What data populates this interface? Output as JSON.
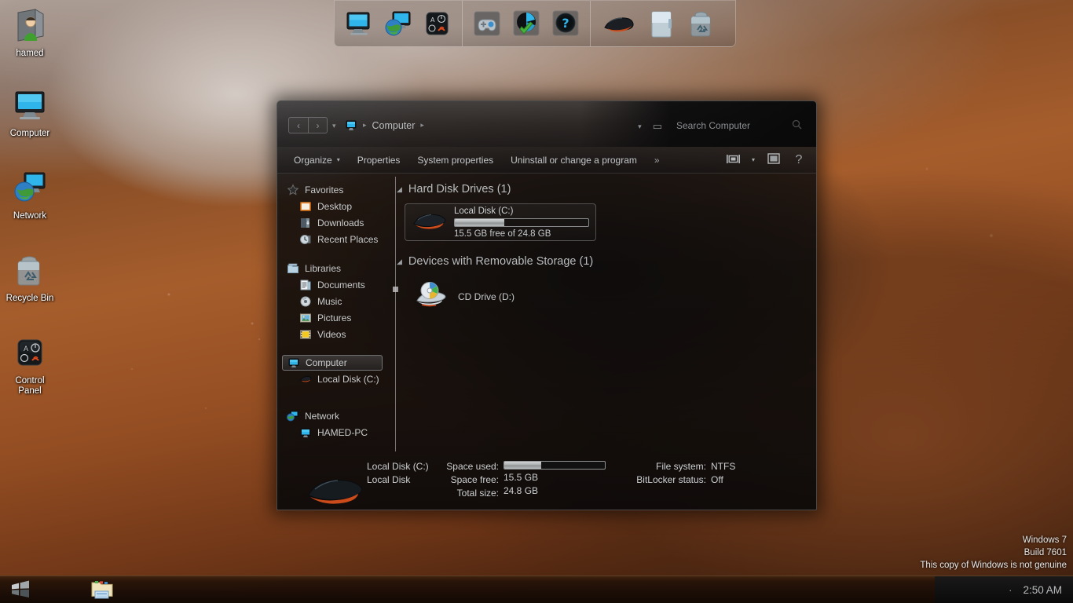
{
  "desktop": {
    "icons": [
      {
        "label": "hamed",
        "icon": "user-folder-icon"
      },
      {
        "label": "Computer",
        "icon": "computer-icon"
      },
      {
        "label": "Network",
        "icon": "network-icon"
      },
      {
        "label": "Recycle Bin",
        "icon": "recycle-bin-icon"
      },
      {
        "label": "Control\nPanel",
        "label_line1": "Control",
        "label_line2": "Panel",
        "icon": "control-panel-icon"
      }
    ]
  },
  "dock": {
    "items": [
      {
        "name": "computer-icon"
      },
      {
        "name": "network-icon"
      },
      {
        "name": "control-panel-icon"
      },
      {
        "name": "games-controller-icon"
      },
      {
        "name": "default-programs-icon"
      },
      {
        "name": "help-and-support-icon"
      },
      {
        "name": "devices-and-printers-icon"
      },
      {
        "name": "documents-folder-icon"
      },
      {
        "name": "recycle-bin-icon"
      }
    ]
  },
  "explorer": {
    "title_bar": {
      "back_glyph": "‹",
      "forward_glyph": "›",
      "history_caret": "▾",
      "breadcrumb": {
        "root_icon": "computer-icon",
        "items": [
          "Computer"
        ],
        "separator": "▸"
      },
      "search_placeholder": "Search Computer",
      "search_icon": "search-icon",
      "minimize_glyph": "▾",
      "maximize_glyph": "▭",
      "close_glyph": "✕"
    },
    "toolbar": {
      "organize_label": "Organize",
      "organize_caret": "▾",
      "properties_label": "Properties",
      "system_properties_label": "System properties",
      "uninstall_label": "Uninstall or change a program",
      "overflow_label": "»",
      "view_icon": "change-view-icon",
      "view_caret": "▾",
      "preview_icon": "preview-pane-icon",
      "help_icon": "help-icon",
      "help_glyph": "?"
    },
    "nav_pane": {
      "groups": [
        {
          "header": {
            "label": "Favorites",
            "icon": "favorites-star-icon"
          },
          "items": [
            {
              "label": "Desktop",
              "icon": "desktop-icon"
            },
            {
              "label": "Downloads",
              "icon": "downloads-icon"
            },
            {
              "label": "Recent Places",
              "icon": "recent-places-icon"
            }
          ]
        },
        {
          "header": {
            "label": "Libraries",
            "icon": "libraries-icon"
          },
          "items": [
            {
              "label": "Documents",
              "icon": "documents-icon"
            },
            {
              "label": "Music",
              "icon": "music-icon"
            },
            {
              "label": "Pictures",
              "icon": "pictures-icon"
            },
            {
              "label": "Videos",
              "icon": "videos-icon"
            }
          ]
        },
        {
          "header": {
            "label": "Computer",
            "icon": "computer-icon",
            "selected": true
          },
          "items": [
            {
              "label": "Local Disk (C:)",
              "icon": "hard-disk-icon"
            }
          ]
        },
        {
          "header": {
            "label": "Network",
            "icon": "network-icon"
          },
          "items": [
            {
              "label": "HAMED-PC",
              "icon": "computer-icon"
            }
          ]
        }
      ]
    },
    "content": {
      "groups": [
        {
          "header": "Hard Disk Drives (1)",
          "arrow": "◢",
          "drives": [
            {
              "name": "Local Disk (C:)",
              "icon": "hard-disk-icon",
              "capacity_text": "15.5 GB free of 24.8 GB",
              "used_percent": 37
            }
          ]
        },
        {
          "header": "Devices with Removable Storage (1)",
          "arrow": "◢",
          "devices": [
            {
              "name": "CD Drive (D:)",
              "icon": "cd-drive-icon"
            }
          ]
        }
      ]
    },
    "details_pane": {
      "icon": "hard-disk-icon",
      "title": "Local Disk (C:)",
      "subtitle": "Local Disk",
      "labels": {
        "space_used": "Space used:",
        "space_free": "Space free:",
        "total_size": "Total size:",
        "file_system": "File system:",
        "bitlocker": "BitLocker status:"
      },
      "values": {
        "space_used_percent": 37,
        "space_free": "15.5 GB",
        "total_size": "24.8 GB",
        "file_system": "NTFS",
        "bitlocker": "Off"
      }
    }
  },
  "watermark": {
    "line1": "Windows 7",
    "line2": "Build 7601",
    "line3": "This copy of Windows is not genuine"
  },
  "taskbar": {
    "start_icon": "windows-start-orb-icon",
    "buttons": [
      {
        "name": "windows-explorer-taskbar-button",
        "icon": "explorer-folder-icon"
      }
    ],
    "tray": {
      "overflow_glyph": "·",
      "clock": "2:50 AM"
    }
  },
  "colors": {
    "accent": "#2aa7e0",
    "window_bg": "#0c0c0d",
    "text": "#cfd2d4",
    "wallpaper_skin": "#a65d2c"
  }
}
